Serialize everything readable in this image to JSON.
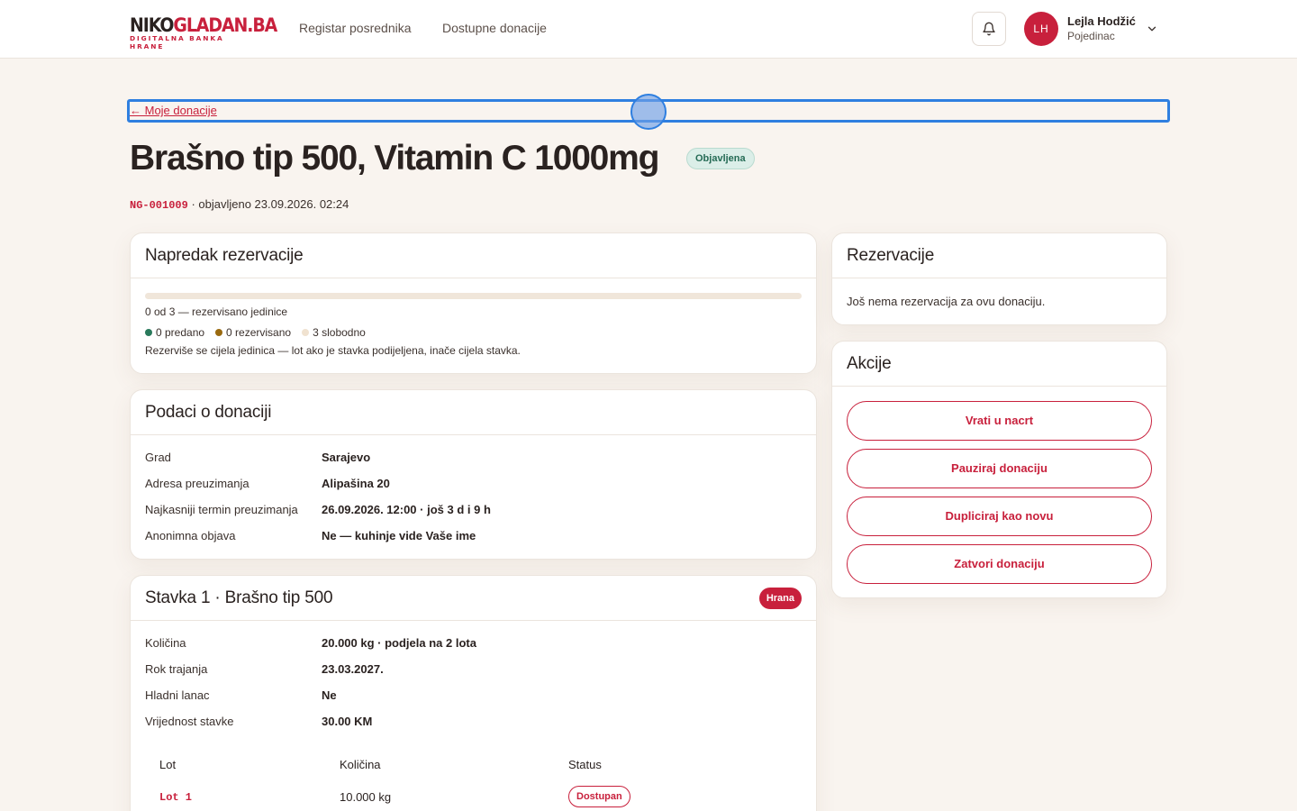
{
  "brand": {
    "logo_main_dark": "NIKO",
    "logo_main_red": "GLADAN.BA",
    "logo_sub": "DIGITALNA BANKA HRANE"
  },
  "nav": {
    "items": [
      {
        "label": "Registar posrednika"
      },
      {
        "label": "Dostupne donacije"
      }
    ]
  },
  "user": {
    "initials": "LH",
    "name": "Lejla Hodžić",
    "role": "Pojedinac"
  },
  "back_link": "← Moje donacije",
  "title": "Brašno tip 500, Vitamin C 1000mg",
  "status": "Objavljena",
  "meta": {
    "code": "NG-001009",
    "published": "· objavljeno 23.09.2026. 02:24"
  },
  "progress_card": {
    "title": "Napredak rezervacije",
    "reserved_fraction": 0,
    "summary": "0 od 3 — rezervisano jedinice",
    "legend": [
      {
        "label": "0 predano",
        "color": "#2a7a5c"
      },
      {
        "label": "0 rezervisano",
        "color": "#9a6a10"
      },
      {
        "label": "3 slobodno",
        "color": "#f0e2d0"
      }
    ],
    "note": "Rezerviše se cijela jedinica — lot ako je stavka podijeljena, inače cijela stavka."
  },
  "details_card": {
    "title": "Podaci o donaciji",
    "rows": [
      {
        "key": "Grad",
        "value": "Sarajevo"
      },
      {
        "key": "Adresa preuzimanja",
        "value": "Alipašina 20"
      },
      {
        "key": "Najkasniji termin preuzimanja",
        "value": "26.09.2026. 12:00 · još 3 d i 9 h"
      },
      {
        "key": "Anonimna objava",
        "value": "Ne — kuhinje vide Vaše ime"
      }
    ]
  },
  "item_card": {
    "title": "Stavka 1 · Brašno tip 500",
    "badge": "Hrana",
    "rows": [
      {
        "key": "Količina",
        "value": "20.000 kg · podjela na 2 lota"
      },
      {
        "key": "Rok trajanja",
        "value": "23.03.2027."
      },
      {
        "key": "Hladni lanac",
        "value": "Ne"
      },
      {
        "key": "Vrijednost stavke",
        "value": "30.00 KM"
      }
    ],
    "lot_headers": {
      "lot": "Lot",
      "qty": "Količina",
      "status": "Status"
    },
    "lots": [
      {
        "lot": "Lot 1",
        "qty": "10.000 kg",
        "status": "Dostupan"
      }
    ]
  },
  "reservations_card": {
    "title": "Rezervacije",
    "empty": "Još nema rezervacija za ovu donaciju."
  },
  "actions_card": {
    "title": "Akcije",
    "buttons": [
      {
        "label": "Vrati u nacrt"
      },
      {
        "label": "Pauziraj donaciju"
      },
      {
        "label": "Dupliciraj kao novu"
      },
      {
        "label": "Zatvori donaciju"
      }
    ]
  },
  "colors": {
    "accent": "#c8203c",
    "background": "#f9f4ef",
    "success": "#2a7a5c"
  },
  "icons": {
    "notifications": "bell-icon",
    "user_menu": "chevron-down-icon"
  }
}
